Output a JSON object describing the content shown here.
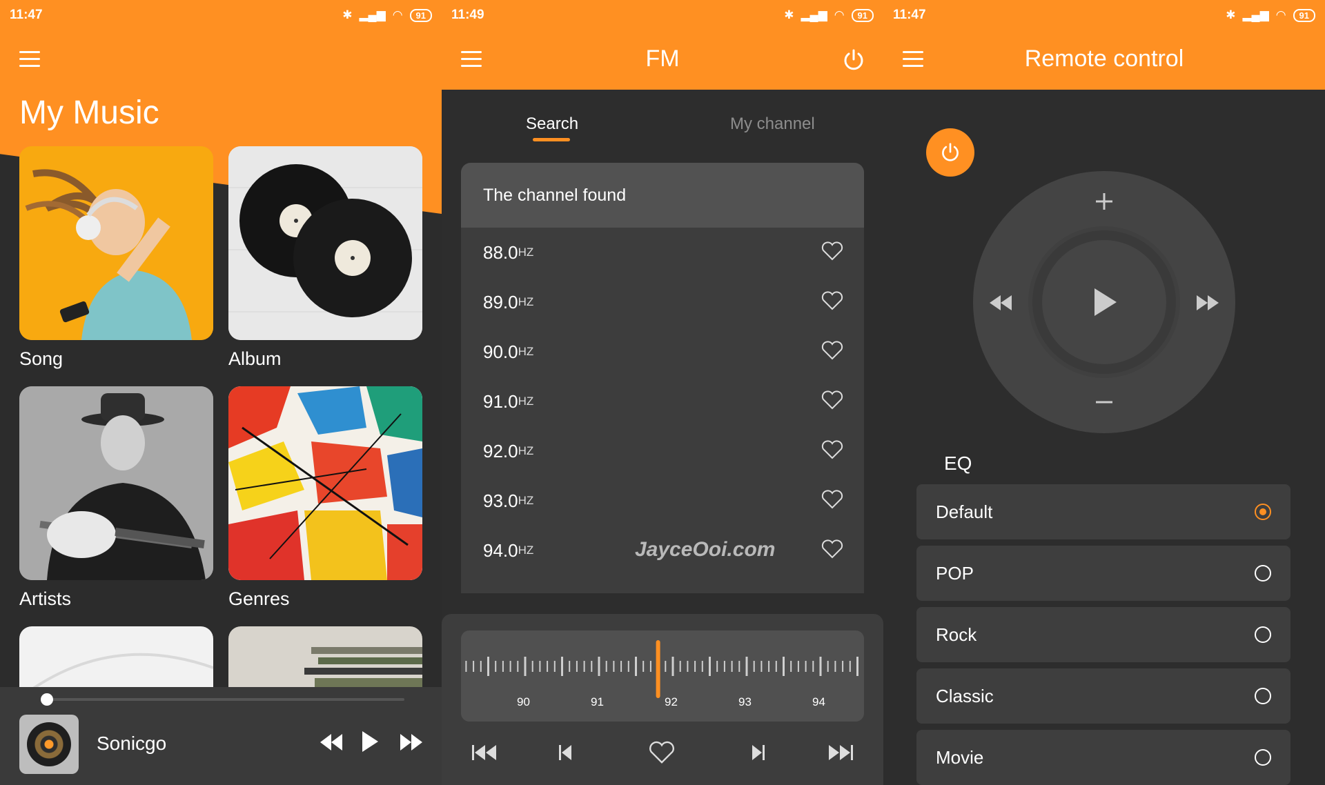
{
  "colors": {
    "accent": "#ff9022",
    "background": "#2d2d2d",
    "card": "#3d3d3d"
  },
  "my_music": {
    "status": {
      "time": "11:47",
      "battery": "91"
    },
    "title": "My Music",
    "tiles": [
      {
        "label": "Song",
        "icon": "dancing-woman-headphones-photo"
      },
      {
        "label": "Album",
        "icon": "vinyl-records-photo"
      },
      {
        "label": "Artists",
        "icon": "guitarist-photo"
      },
      {
        "label": "Genres",
        "icon": "paint-splash-photo"
      }
    ],
    "player": {
      "song": "Sonicgo",
      "progress": 0.01
    }
  },
  "fm": {
    "status": {
      "time": "11:49",
      "battery": "91"
    },
    "title": "FM",
    "tabs": [
      {
        "label": "Search"
      },
      {
        "label": "My channel"
      }
    ],
    "list_header": "The channel found",
    "channels": [
      {
        "freq": "88.0",
        "unit": "HZ"
      },
      {
        "freq": "89.0",
        "unit": "HZ"
      },
      {
        "freq": "90.0",
        "unit": "HZ"
      },
      {
        "freq": "91.0",
        "unit": "HZ"
      },
      {
        "freq": "92.0",
        "unit": "HZ"
      },
      {
        "freq": "93.0",
        "unit": "HZ"
      },
      {
        "freq": "94.0",
        "unit": "HZ"
      }
    ],
    "watermark": "JayceOoi.com",
    "tuner_labels": [
      "90",
      "91",
      "92",
      "93",
      "94"
    ],
    "tuned_frequency": 91.8
  },
  "remote": {
    "status": {
      "time": "11:47",
      "battery": "91"
    },
    "title": "Remote control",
    "eq_label": "EQ",
    "eq_options": [
      {
        "label": "Default",
        "selected": true
      },
      {
        "label": "POP",
        "selected": false
      },
      {
        "label": "Rock",
        "selected": false
      },
      {
        "label": "Classic",
        "selected": false
      },
      {
        "label": "Movie",
        "selected": false
      }
    ]
  }
}
